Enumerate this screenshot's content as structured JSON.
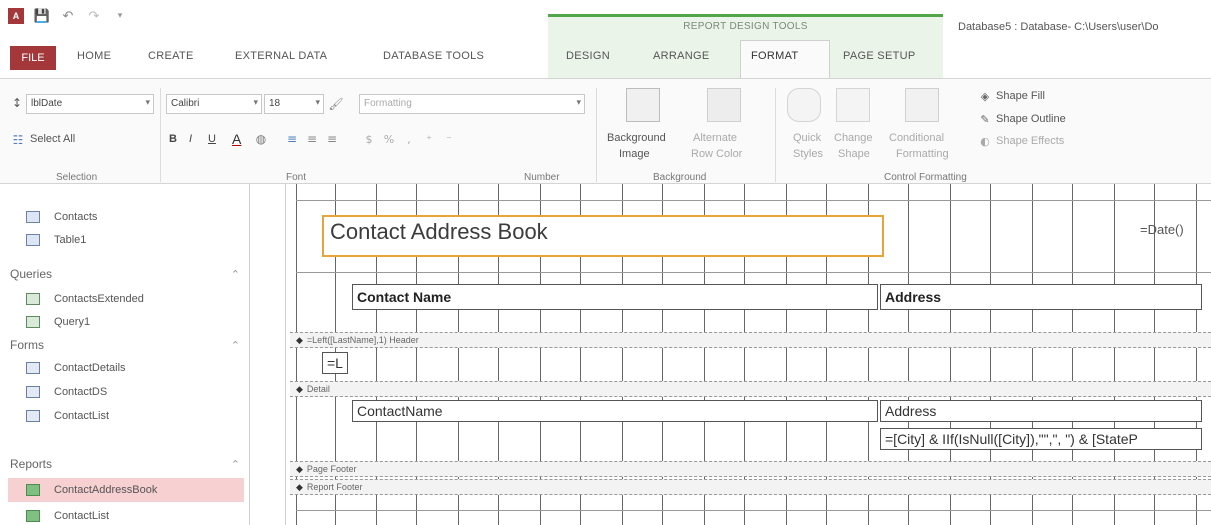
{
  "title_bar": {
    "context_label": "REPORT DESIGN TOOLS",
    "window_title": "Database5 : Database- C:\\Users\\user\\Do"
  },
  "tabs": {
    "file": "FILE",
    "home": "HOME",
    "create": "CREATE",
    "external_data": "EXTERNAL DATA",
    "database_tools": "DATABASE TOOLS",
    "design": "DESIGN",
    "arrange": "ARRANGE",
    "format": "FORMAT",
    "page_setup": "PAGE SETUP"
  },
  "ribbon": {
    "selection": {
      "object_combo": "lblDate",
      "select_all": "Select All",
      "group_label": "Selection"
    },
    "font": {
      "font_name": "Calibri",
      "font_size": "18",
      "group_label": "Font",
      "bold": "B",
      "italic": "I",
      "underline": "U",
      "font_color": "A"
    },
    "number": {
      "formatting": "Formatting",
      "group_label": "Number"
    },
    "background": {
      "background_image": "Background",
      "background_image_sub": "Image",
      "alternate_row": "Alternate",
      "alternate_row_sub": "Row Color",
      "group_label": "Background"
    },
    "control_formatting": {
      "quick_styles": "Quick",
      "quick_styles_sub": "Styles",
      "change_shape": "Change",
      "change_shape_sub": "Shape",
      "conditional": "Conditional",
      "conditional_sub": "Formatting",
      "shape_fill": "Shape Fill",
      "shape_outline": "Shape Outline",
      "shape_effects": "Shape Effects",
      "group_label": "Control Formatting"
    }
  },
  "nav": {
    "items": [
      {
        "label": "Contacts",
        "kind": "table"
      },
      {
        "label": "Table1",
        "kind": "table"
      }
    ],
    "groups": {
      "queries": "Queries",
      "forms": "Forms",
      "reports": "Reports"
    },
    "queries": [
      {
        "label": "ContactsExtended"
      },
      {
        "label": "Query1"
      }
    ],
    "forms": [
      {
        "label": "ContactDetails"
      },
      {
        "label": "ContactDS"
      },
      {
        "label": "ContactList"
      }
    ],
    "reports": [
      {
        "label": "ContactAddressBook"
      },
      {
        "label": "ContactList"
      }
    ]
  },
  "design": {
    "report_title": "Contact Address Book",
    "date_field": "=Date()",
    "header_contact_name": "Contact Name",
    "header_address": "Address",
    "group_header_band": "=Left([LastName],1) Header",
    "group_header_field": "=L",
    "detail_band": "Detail",
    "detail_contact_name": "ContactName",
    "detail_address": "Address",
    "detail_city_expr": "=[City] & IIf(IsNull([City]),\"\",\", \") & [StateP",
    "page_footer_band": "Page Footer",
    "report_footer_band": "Report Footer"
  }
}
